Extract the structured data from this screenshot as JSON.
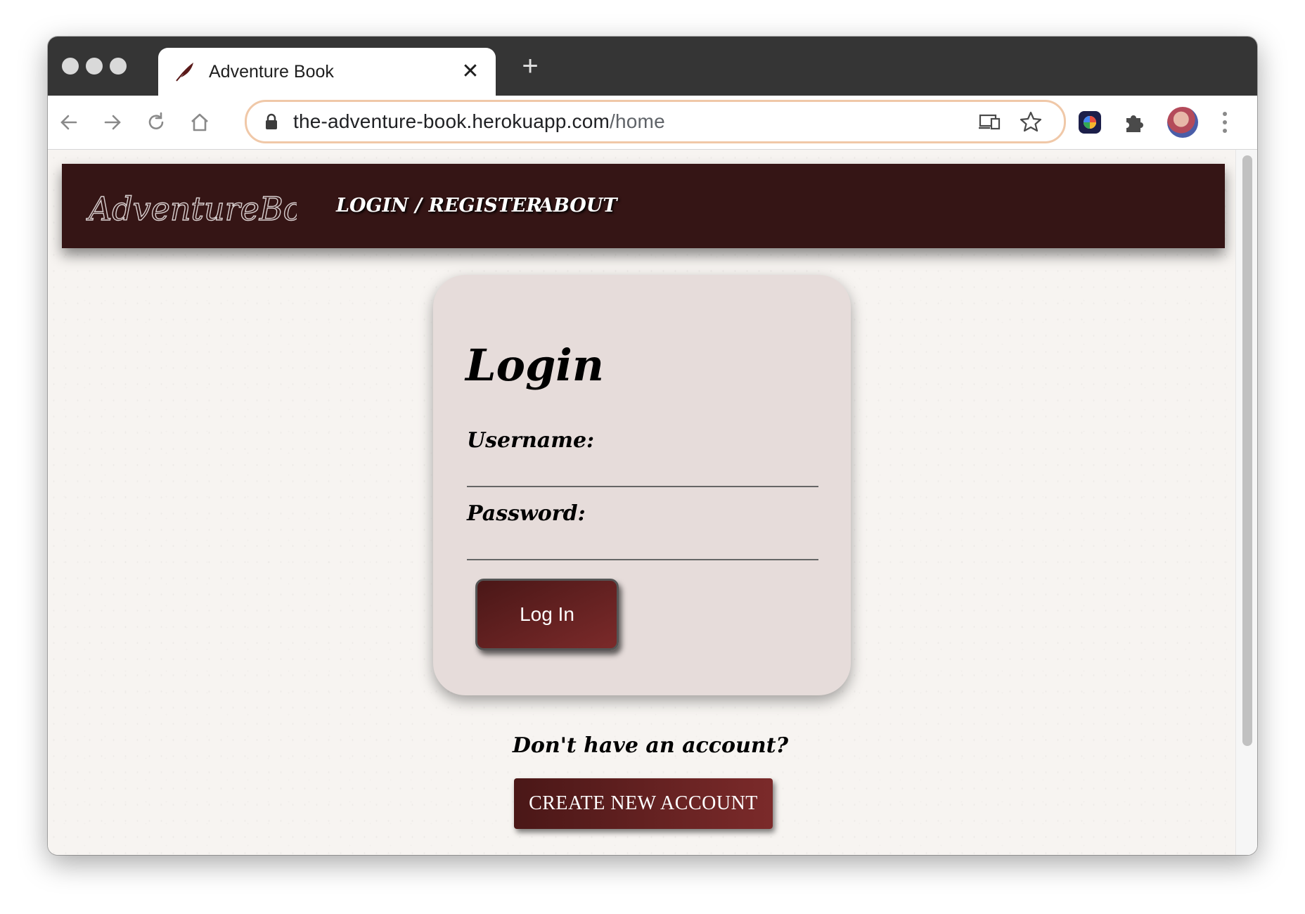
{
  "browser": {
    "tab_title": "Adventure Book",
    "close_symbol": "✕",
    "new_tab_symbol": "+",
    "url_host": "the-adventure-book.herokuapp.com",
    "url_path": "/home"
  },
  "site": {
    "logo_text": "AdventureBook",
    "nav": {
      "login_register": "LOGIN / REGISTER",
      "about": "ABOUT"
    }
  },
  "login_card": {
    "title": "Login",
    "username_label": "Username:",
    "username_value": "",
    "password_label": "Password:",
    "password_value": "",
    "submit_label": "Log In"
  },
  "signup": {
    "prompt": "Don't have an account?",
    "button_label": "CREATE NEW ACCOUNT"
  },
  "colors": {
    "nav_bg": "#351515",
    "button_dark": "#4a1717",
    "button_light": "#7b2a2a",
    "card_bg": "#e6dcda",
    "page_bg": "#f7f4f1"
  },
  "icons": [
    "feather-icon",
    "close-icon",
    "plus-icon",
    "back-arrow-icon",
    "forward-arrow-icon",
    "reload-icon",
    "home-icon",
    "lock-icon",
    "install-app-icon",
    "star-icon",
    "extension-app-icon",
    "puzzle-icon",
    "kebab-menu-icon"
  ]
}
